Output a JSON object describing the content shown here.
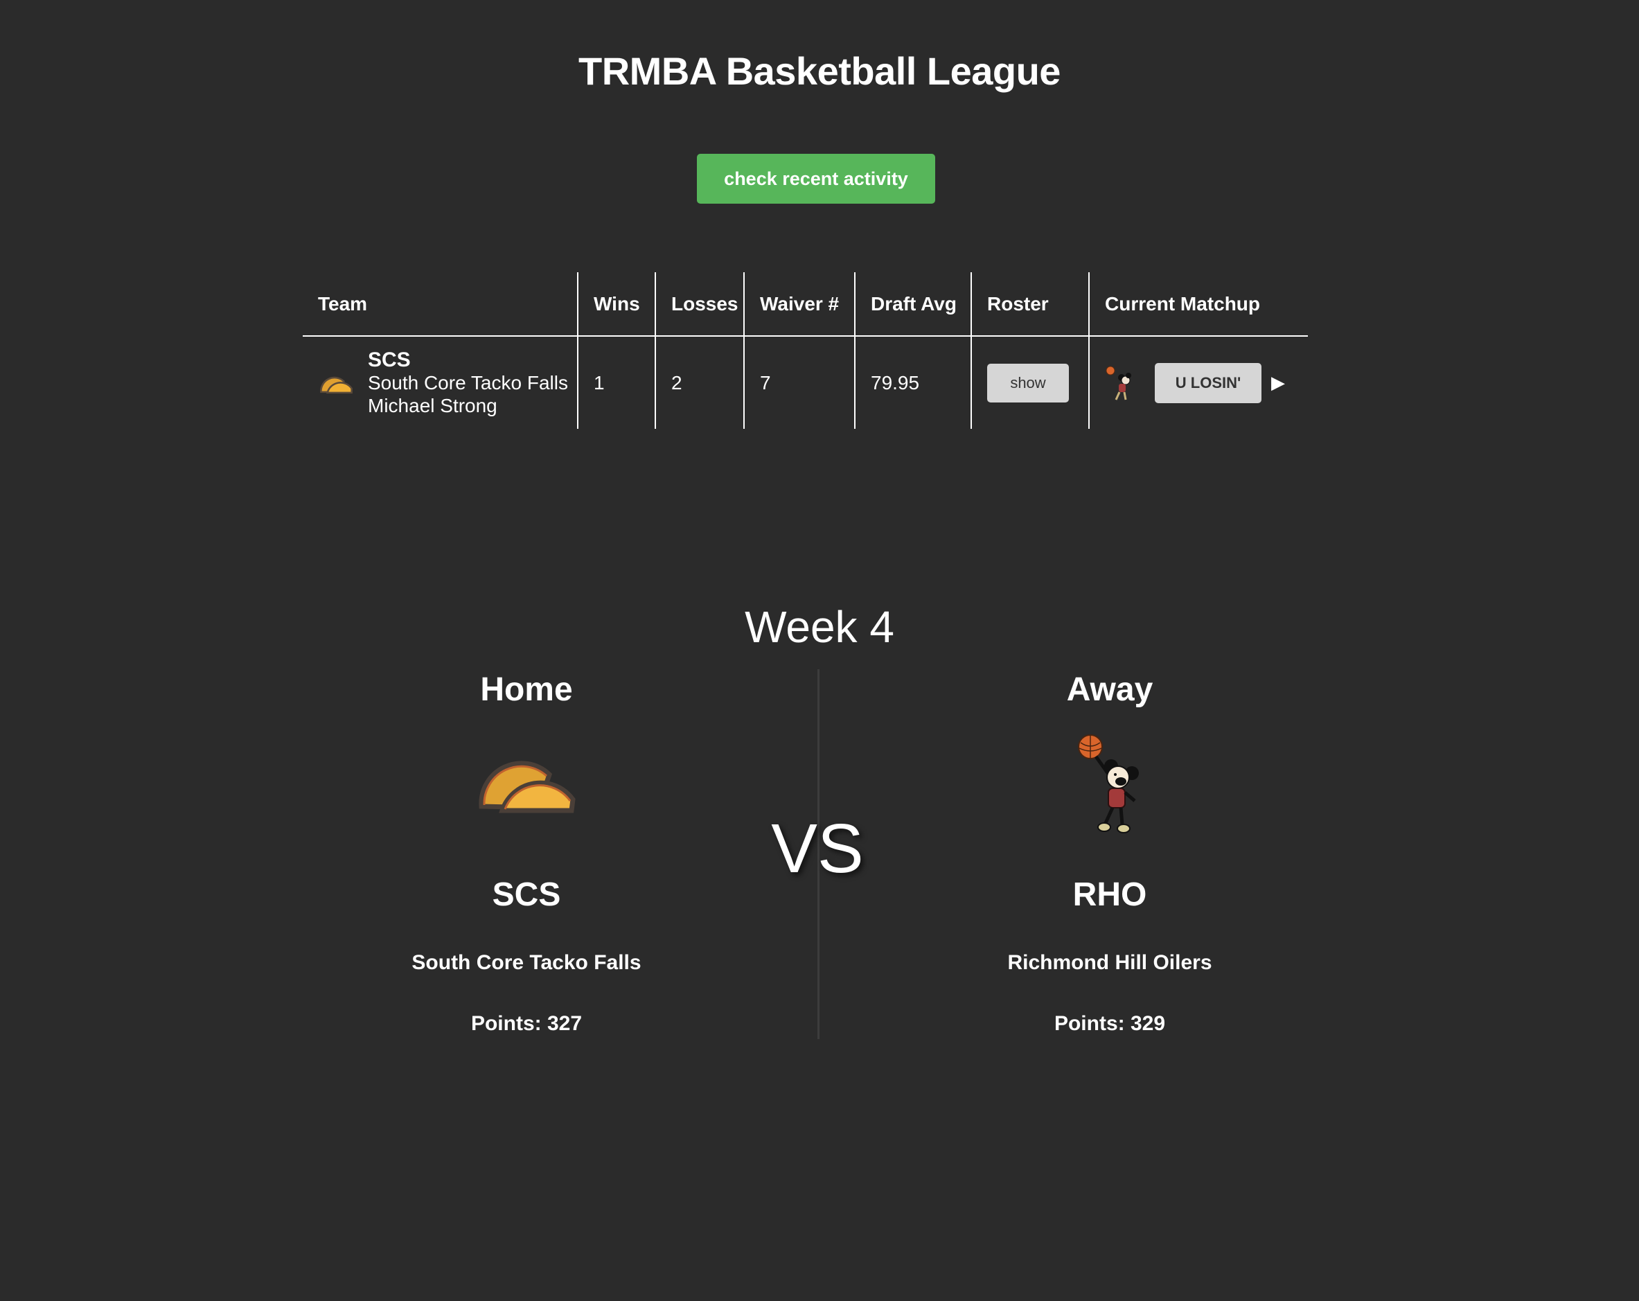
{
  "league": {
    "title": "TRMBA Basketball League",
    "activity_button": "check recent activity"
  },
  "standings": {
    "headers": [
      "Team",
      "Wins",
      "Losses",
      "Waiver #",
      "Draft Avg",
      "Roster",
      "Current Matchup"
    ],
    "rows": [
      {
        "abbr": "SCS",
        "name": "South Core Tacko Falls",
        "owner": "Michael Strong",
        "logo_icon": "taco-icon",
        "wins": "1",
        "losses": "2",
        "waiver": "7",
        "draft_avg": "79.95",
        "roster_button": "show",
        "opponent_icon": "mickey-basketball-icon",
        "matchup_button": "U LOSIN'",
        "expand_icon": "play-arrow-icon"
      }
    ]
  },
  "matchup": {
    "week": "Week 4",
    "vs": "VS",
    "home": {
      "label": "Home",
      "abbr": "SCS",
      "name": "South Core Tacko Falls",
      "points": "Points: 327",
      "logo_icon": "taco-icon"
    },
    "away": {
      "label": "Away",
      "abbr": "RHO",
      "name": "Richmond Hill Oilers",
      "points": "Points: 329",
      "logo_icon": "mickey-basketball-icon"
    }
  },
  "colors": {
    "background": "#2b2b2b",
    "activity_button": "#57b65a",
    "grey_button": "#d6d6d6",
    "taco_shell": "#f2b134"
  }
}
